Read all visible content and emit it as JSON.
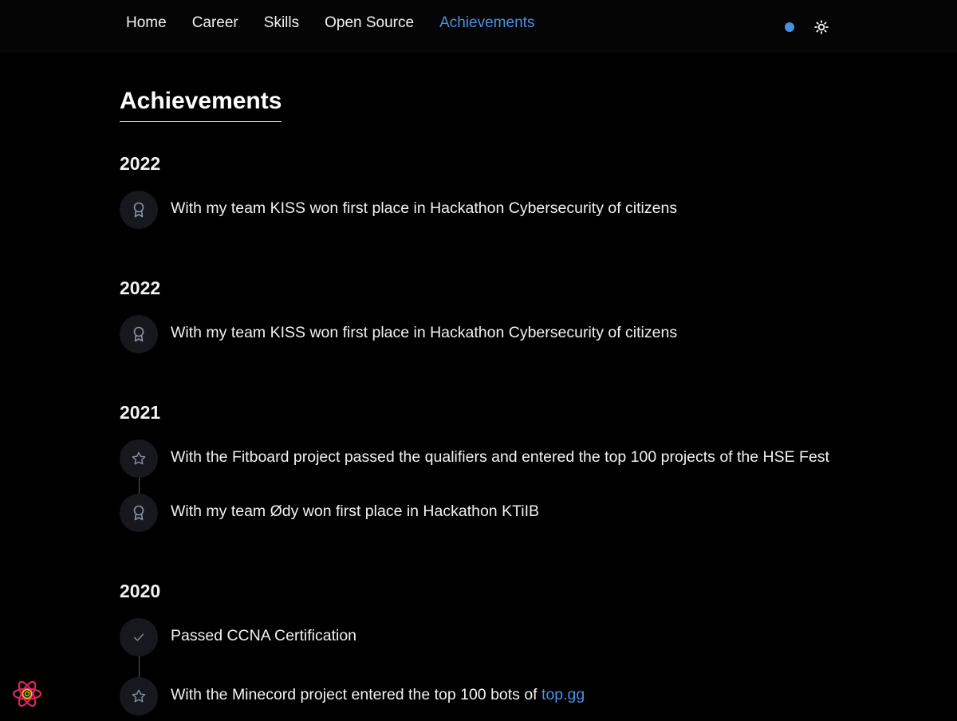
{
  "nav": {
    "items": [
      {
        "label": "Home"
      },
      {
        "label": "Career"
      },
      {
        "label": "Skills"
      },
      {
        "label": "Open Source"
      },
      {
        "label": "Achievements",
        "active": true
      }
    ],
    "accent_color": "#4a90e2"
  },
  "page": {
    "title": "Achievements"
  },
  "sections": [
    {
      "year": "2022",
      "items": [
        {
          "icon": "award-icon",
          "text": "With my team KISS won first place in Hackathon Cybersecurity of citizens"
        }
      ]
    },
    {
      "year": "2022",
      "items": [
        {
          "icon": "award-icon",
          "text": "With my team KISS won first place in Hackathon Cybersecurity of citizens"
        }
      ]
    },
    {
      "year": "2021",
      "items": [
        {
          "icon": "star-icon",
          "text": "With the Fitboard project passed the qualifiers and entered the top 100 projects of the HSE Fest"
        },
        {
          "icon": "award-icon",
          "text": "With my team Ødy won first place in Hackathon KTiIB"
        }
      ]
    },
    {
      "year": "2020",
      "items": [
        {
          "icon": "check-icon",
          "text": "Passed CCNA Certification"
        },
        {
          "icon": "star-icon",
          "text": "With the Minecord project entered the top 100 bots of ",
          "link": "top.gg"
        }
      ]
    }
  ]
}
